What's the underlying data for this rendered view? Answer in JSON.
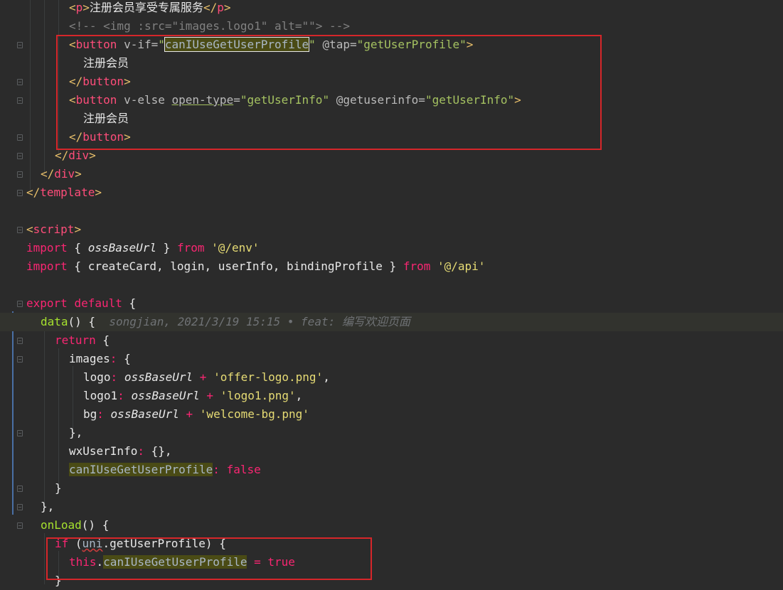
{
  "editor": {
    "lines": [
      {
        "tokens": [
          [
            "brk",
            "<"
          ],
          [
            "tn",
            "p"
          ],
          [
            "brk",
            ">"
          ],
          [
            "pl",
            "注册会员享受专属服务"
          ],
          [
            "brk",
            "</"
          ],
          [
            "tn",
            "p"
          ],
          [
            "brk",
            ">"
          ]
        ]
      },
      {
        "tokens": [
          [
            "cmt",
            "<!-- <img :src=\"images.logo1\" alt=\"\"> -->"
          ]
        ]
      },
      {
        "tokens": [
          [
            "brk",
            "<"
          ],
          [
            "tn",
            "button"
          ],
          [
            "attr",
            " v-if="
          ],
          [
            "val",
            "\""
          ],
          [
            "box",
            "canIUseGetUserProfile"
          ],
          [
            "val",
            "\""
          ],
          [
            "attr",
            " @tap="
          ],
          [
            "val",
            "\"getUserProfile\""
          ],
          [
            "brk",
            ">"
          ]
        ]
      },
      {
        "tokens": [
          [
            "pl",
            "注册会员"
          ]
        ]
      },
      {
        "tokens": [
          [
            "brk",
            "</"
          ],
          [
            "tn",
            "button"
          ],
          [
            "brk",
            ">"
          ]
        ]
      },
      {
        "tokens": [
          [
            "brk",
            "<"
          ],
          [
            "tn",
            "button"
          ],
          [
            "attr",
            " v-else "
          ],
          [
            "attrul",
            "open-type"
          ],
          [
            "attr",
            "="
          ],
          [
            "val",
            "\"getUserInfo\""
          ],
          [
            "attr",
            " @getuserinfo="
          ],
          [
            "val",
            "\"getUserInfo\""
          ],
          [
            "brk",
            ">"
          ]
        ]
      },
      {
        "tokens": [
          [
            "pl",
            "注册会员"
          ]
        ]
      },
      {
        "tokens": [
          [
            "brk",
            "</"
          ],
          [
            "tn",
            "button"
          ],
          [
            "brk",
            ">"
          ]
        ]
      },
      {
        "tokens": [
          [
            "brk",
            "</"
          ],
          [
            "tn",
            "div"
          ],
          [
            "brk",
            ">"
          ]
        ]
      },
      {
        "tokens": [
          [
            "brk",
            "</"
          ],
          [
            "tn",
            "div"
          ],
          [
            "brk",
            ">"
          ]
        ]
      },
      {
        "tokens": [
          [
            "brk",
            "</"
          ],
          [
            "tn",
            "template"
          ],
          [
            "brk",
            ">"
          ]
        ]
      },
      {
        "tokens": []
      },
      {
        "tokens": [
          [
            "brk",
            "<"
          ],
          [
            "tn",
            "script"
          ],
          [
            "brk",
            ">"
          ]
        ]
      },
      {
        "tokens": [
          [
            "kw",
            "import"
          ],
          [
            "pl",
            " { "
          ],
          [
            "ital",
            "ossBaseUrl"
          ],
          [
            "pl",
            " } "
          ],
          [
            "kw",
            "from"
          ],
          [
            "pl",
            " "
          ],
          [
            "str",
            "'@/env'"
          ]
        ]
      },
      {
        "tokens": [
          [
            "kw",
            "import"
          ],
          [
            "pl",
            " { createCard, login, userInfo, bindingProfile } "
          ],
          [
            "kw",
            "from"
          ],
          [
            "pl",
            " "
          ],
          [
            "str",
            "'@/api'"
          ]
        ]
      },
      {
        "tokens": []
      },
      {
        "tokens": [
          [
            "kw",
            "export"
          ],
          [
            "pl",
            " "
          ],
          [
            "kw",
            "default"
          ],
          [
            "pl",
            " {"
          ]
        ]
      },
      {
        "tokens": [
          [
            "fn",
            "data"
          ],
          [
            "pl",
            "() {  "
          ],
          [
            "ann",
            "songjian, 2021/3/19 15:15 • feat: 编写欢迎页面"
          ]
        ]
      },
      {
        "tokens": [
          [
            "kw",
            "return"
          ],
          [
            "pl",
            " {"
          ]
        ]
      },
      {
        "tokens": [
          [
            "prop",
            "images"
          ],
          [
            "op",
            ":"
          ],
          [
            "pl",
            " {"
          ]
        ]
      },
      {
        "tokens": [
          [
            "prop",
            "logo"
          ],
          [
            "op",
            ":"
          ],
          [
            "pl",
            " "
          ],
          [
            "ital",
            "ossBaseUrl"
          ],
          [
            "pl",
            " "
          ],
          [
            "op",
            "+"
          ],
          [
            "pl",
            " "
          ],
          [
            "str",
            "'offer-logo.png'"
          ],
          [
            "pl",
            ","
          ]
        ]
      },
      {
        "tokens": [
          [
            "prop",
            "logo1"
          ],
          [
            "op",
            ":"
          ],
          [
            "pl",
            " "
          ],
          [
            "ital",
            "ossBaseUrl"
          ],
          [
            "pl",
            " "
          ],
          [
            "op",
            "+"
          ],
          [
            "pl",
            " "
          ],
          [
            "str",
            "'logo1.png'"
          ],
          [
            "pl",
            ","
          ]
        ]
      },
      {
        "tokens": [
          [
            "prop",
            "bg"
          ],
          [
            "op",
            ":"
          ],
          [
            "pl",
            " "
          ],
          [
            "ital",
            "ossBaseUrl"
          ],
          [
            "pl",
            " "
          ],
          [
            "op",
            "+"
          ],
          [
            "pl",
            " "
          ],
          [
            "str",
            "'welcome-bg.png'"
          ]
        ]
      },
      {
        "tokens": [
          [
            "pl",
            "},"
          ]
        ]
      },
      {
        "tokens": [
          [
            "prop",
            "wxUserInfo"
          ],
          [
            "op",
            ":"
          ],
          [
            "pl",
            " {},"
          ]
        ]
      },
      {
        "tokens": [
          [
            "mark",
            "canIUseGetUserProfile"
          ],
          [
            "op",
            ":"
          ],
          [
            "pl",
            " "
          ],
          [
            "kw",
            "false"
          ]
        ]
      },
      {
        "tokens": [
          [
            "pl",
            "}"
          ]
        ]
      },
      {
        "tokens": [
          [
            "pl",
            "},"
          ]
        ]
      },
      {
        "tokens": [
          [
            "fn",
            "onLoad"
          ],
          [
            "pl",
            "() {"
          ]
        ]
      },
      {
        "tokens": [
          [
            "kw",
            "if"
          ],
          [
            "pl",
            " ("
          ],
          [
            "sq",
            "uni"
          ],
          [
            "pl",
            ".getUserProfile) {"
          ]
        ]
      },
      {
        "tokens": [
          [
            "kw",
            "this"
          ],
          [
            "pl",
            "."
          ],
          [
            "mark",
            "canIUseGetUserProfile"
          ],
          [
            "pl",
            " "
          ],
          [
            "op",
            "="
          ],
          [
            "pl",
            " "
          ],
          [
            "kw",
            "true"
          ]
        ]
      },
      {
        "tokens": [
          [
            "pl",
            "}"
          ]
        ]
      }
    ],
    "blame": "songjian, 2021/3/19 15:15 • feat: 编写欢迎页面"
  }
}
